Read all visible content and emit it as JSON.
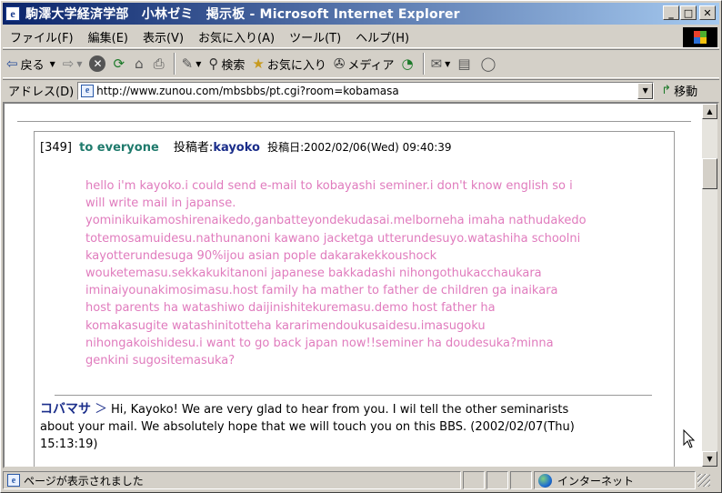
{
  "window": {
    "title": "駒澤大学経済学部　小林ゼミ　掲示板 - Microsoft Internet Explorer",
    "controls": {
      "minimize": "_",
      "maximize": "□",
      "close": "✕"
    }
  },
  "menu": [
    "ファイル(F)",
    "編集(E)",
    "表示(V)",
    "お気に入り(A)",
    "ツール(T)",
    "ヘルプ(H)"
  ],
  "toolbar": {
    "back": "戻る",
    "search": "検索",
    "favorites": "お気に入り",
    "media": "メディア"
  },
  "address": {
    "label": "アドレス(D)",
    "url": "http://www.zunou.com/mbsbbs/pt.cgi?room=kobamasa",
    "go": "移動"
  },
  "post": {
    "number": "[349]",
    "subject": "to everyone",
    "author_label": "投稿者:",
    "author": "kayoko",
    "date_label": "投稿日:2002/02/06(Wed) 09:40:39",
    "body_lines": [
      "hello i'm kayoko.i could send e-mail to kobayashi seminer.i don't know english so i",
      "will write mail in japanse.",
      "yominikuikamoshirenaikedo,ganbatteyondekudasai.melborneha imaha nathudakedo",
      "totemosamuidesu.nathunanoni kawano jacketga utterundesuyo.watashiha schoolni",
      "kayotterundesuga 90%ijou asian pople dakarakekkoushock",
      "wouketemasu.sekkakukitanoni japanese bakkadashi nihongothukacchaukara",
      "iminaiyounakimosimasu.host family ha mather to father de children ga inaikara",
      "host parents ha watashiwo daijinishitekuremasu.demo host father ha",
      "komakasugite watashinitotteha kararimendoukusaidesu.imasugoku",
      "nihongakoishidesu.i want to go back japan now!!seminer ha doudesuka?minna",
      "genkini sugositemasuka?"
    ]
  },
  "reply": {
    "author": "コバマサ",
    "arrow": "＞",
    "text_lines": [
      "Hi, Kayoko! We are very glad to hear from you. I wil tell the other seminarists",
      "about your mail. We absolutely hope that we will touch you on this BBS. (2002/02/07(Thu)",
      "15:13:19)"
    ]
  },
  "status": {
    "text": "ページが表示されました",
    "zone": "インターネット"
  },
  "colors": {
    "title_bar": "#0a246a",
    "post_body": "#e07bbd",
    "subject": "#1f7a6c",
    "author": "#1a2d8a"
  }
}
